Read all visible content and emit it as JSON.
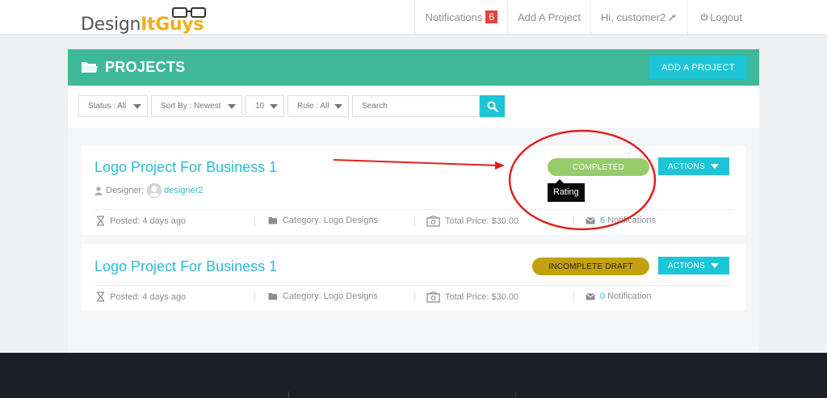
{
  "logo": {
    "part1": "Design",
    "part2": "ItGuys"
  },
  "nav": {
    "notifications_label": "Notifications",
    "notifications_count": "6",
    "add_project": "Add A Project",
    "greeting": "Hi, customer2",
    "logout": "Logout"
  },
  "panel": {
    "title": "PROJECTS",
    "add_button": "ADD A PROJECT"
  },
  "filters": {
    "status": "Status : All",
    "sort": "Sort By : Newest",
    "per_page": "10",
    "role": "Role : All",
    "search_placeholder": "Search"
  },
  "projects": [
    {
      "title": "Logo Project For Business 1",
      "designer_label": "Designer:",
      "designer_name": "designer2",
      "status": "COMPLETED",
      "tooltip": "Rating",
      "actions": "ACTIONS",
      "posted": "Posted: 4 days ago",
      "category": "Category: Logo Designs",
      "price": "Total Price: $30.00",
      "notif_count": "6",
      "notif_label": "Notifications"
    },
    {
      "title": "Logo Project For Business 1",
      "status": "INCOMPLETE DRAFT",
      "actions": "ACTIONS",
      "posted": "Posted: 4 days ago",
      "category": "Category: Logo Designs",
      "price": "Total Price: $30.00",
      "notif_count": "0",
      "notif_label": "Notification"
    }
  ],
  "colors": {
    "teal": "#3fb89a",
    "cyan": "#1cc6d6",
    "completed": "#96cc6a",
    "incomplete": "#c3a00d",
    "annotation": "#e0201c"
  }
}
